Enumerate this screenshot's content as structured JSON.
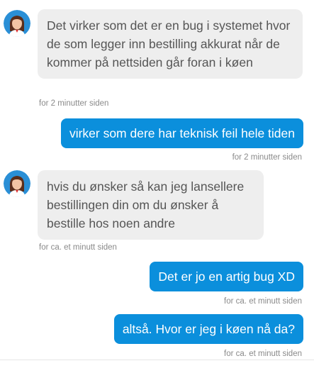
{
  "messages": [
    {
      "sender": "agent",
      "text": "Det virker som det er en bug i systemet hvor de som legger inn bestilling akkurat når de kommer på nettsiden går foran i køen",
      "time": "for 2 minutter siden"
    },
    {
      "sender": "user",
      "text": "virker som dere har teknisk feil hele tiden",
      "time": "for 2 minutter siden"
    },
    {
      "sender": "agent",
      "text": "hvis du ønsker så kan jeg lansellere bestillingen din om du ønsker å bestille hos noen andre",
      "time": "for ca. et minutt siden"
    },
    {
      "sender": "user",
      "text": "Det er jo en artig bug XD",
      "time": "for ca. et minutt siden"
    },
    {
      "sender": "user",
      "text": "altså. Hvor er jeg i køen nå da?",
      "time": "for ca. et minutt siden"
    }
  ],
  "colors": {
    "user_bubble": "#0b8fdc",
    "agent_bubble": "#eeeeee",
    "agent_text": "#555555",
    "timestamp": "#8a8a8a"
  },
  "icons": {
    "agent_avatar": "agent-avatar-icon"
  }
}
